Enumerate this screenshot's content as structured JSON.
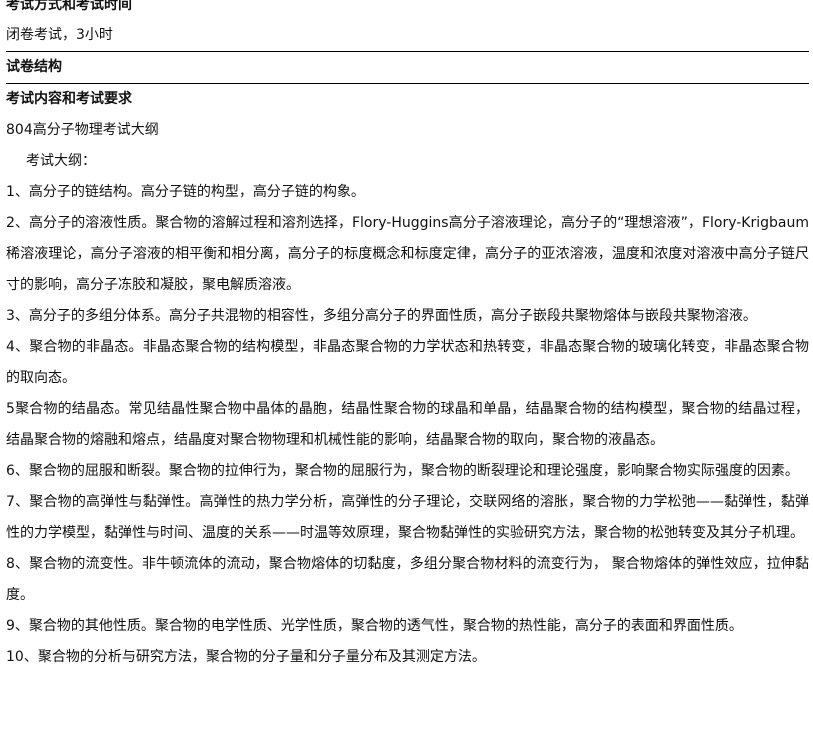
{
  "sections": {
    "exam_method_title": "考试方式和考试时间",
    "exam_method_value": "闭卷考试，3小时",
    "structure_title": "试卷结构",
    "content_title": "考试内容和考试要求"
  },
  "outline": {
    "course_title": "804高分子物理考试大纲",
    "outline_label": "考试大纲：",
    "items": [
      "1、高分子的链结构。高分子链的构型，高分子链的构象。",
      "2、高分子的溶液性质。聚合物的溶解过程和溶剂选择，Flory-Huggins高分子溶液理论，高分子的“理想溶液”，Flory-Krigbaum稀溶液理论，高分子溶液的相平衡和相分离，高分子的标度概念和标度定律，高分子的亚浓溶液，温度和浓度对溶液中高分子链尺寸的影响，高分子冻胶和凝胶，聚电解质溶液。",
      "3、高分子的多组分体系。高分子共混物的相容性，多组分高分子的界面性质，高分子嵌段共聚物熔体与嵌段共聚物溶液。",
      "4、聚合物的非晶态。非晶态聚合物的结构模型，非晶态聚合物的力学状态和热转变，非晶态聚合物的玻璃化转变，非晶态聚合物的取向态。",
      "5聚合物的结晶态。常见结晶性聚合物中晶体的晶胞，结晶性聚合物的球晶和单晶，结晶聚合物的结构模型，聚合物的结晶过程，结晶聚合物的熔融和熔点，结晶度对聚合物物理和机械性能的影响，结晶聚合物的取向，聚合物的液晶态。",
      "6、聚合物的屈服和断裂。聚合物的拉伸行为，聚合物的屈服行为，聚合物的断裂理论和理论强度，影响聚合物实际强度的因素。",
      "7、聚合物的高弹性与黏弹性。高弹性的热力学分析，高弹性的分子理论，交联网络的溶胀，聚合物的力学松弛——黏弹性，黏弹性的力学模型，黏弹性与时间、温度的关系——时温等效原理，聚合物黏弹性的实验研究方法，聚合物的松弛转变及其分子机理。",
      "8、聚合物的流变性。非牛顿流体的流动，聚合物熔体的切黏度，多组分聚合物材料的流变行为， 聚合物熔体的弹性效应，拉伸黏度。",
      "9、聚合物的其他性质。聚合物的电学性质、光学性质，聚合物的透气性，聚合物的热性能，高分子的表面和界面性质。",
      "10、聚合物的分析与研究方法，聚合物的分子量和分子量分布及其测定方法。"
    ]
  }
}
